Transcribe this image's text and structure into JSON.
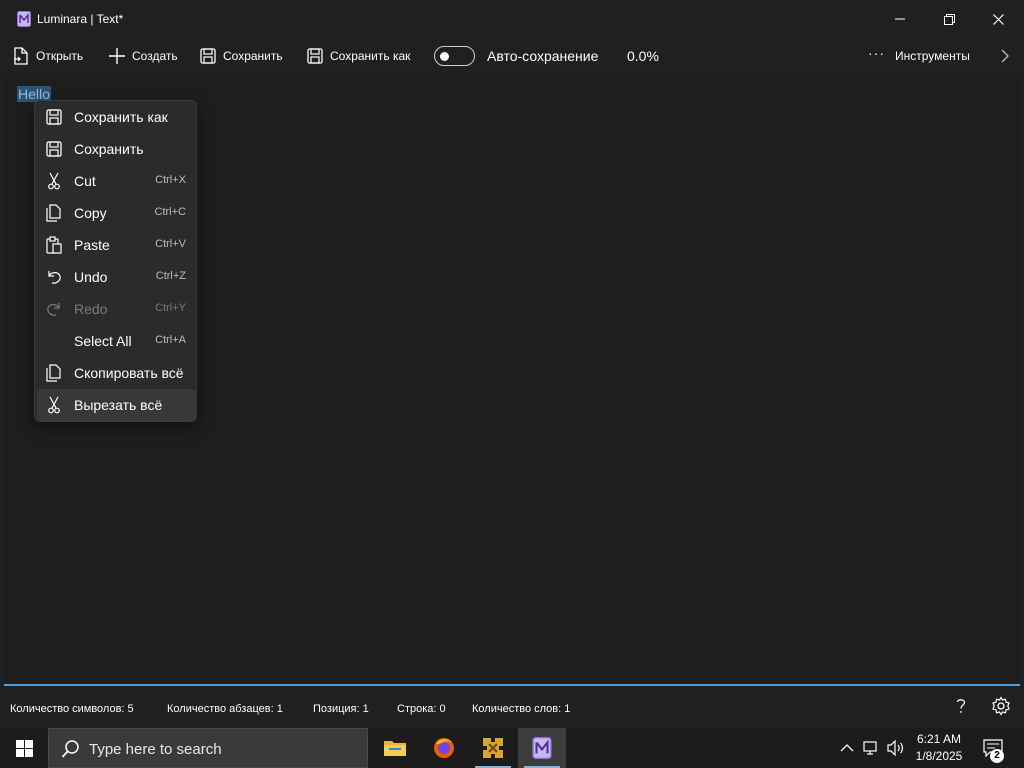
{
  "window": {
    "title": "Luminara | Text*"
  },
  "toolbar": {
    "open_label": "Открыть",
    "new_label": "Создать",
    "save_label": "Сохранить",
    "save_as_label": "Сохранить как",
    "autosave_label": "Авто-сохранение",
    "autosave_on": false,
    "progress_text": "0.0%",
    "tools_label": "Инструменты"
  },
  "editor": {
    "text": "Hello",
    "selected": true
  },
  "context_menu": {
    "items": [
      {
        "label": "Сохранить как",
        "shortcut": "",
        "icon": "save-as-icon",
        "enabled": true
      },
      {
        "label": "Сохранить",
        "shortcut": "",
        "icon": "save-icon",
        "enabled": true
      },
      {
        "label": "Cut",
        "shortcut": "Ctrl+X",
        "icon": "scissors-icon",
        "enabled": true
      },
      {
        "label": "Copy",
        "shortcut": "Ctrl+C",
        "icon": "copy-icon",
        "enabled": true
      },
      {
        "label": "Paste",
        "shortcut": "Ctrl+V",
        "icon": "paste-icon",
        "enabled": true
      },
      {
        "label": "Undo",
        "shortcut": "Ctrl+Z",
        "icon": "undo-icon",
        "enabled": true
      },
      {
        "label": "Redo",
        "shortcut": "Ctrl+Y",
        "icon": "redo-icon",
        "enabled": false
      },
      {
        "label": "Select All",
        "shortcut": "Ctrl+A",
        "icon": "",
        "enabled": true
      },
      {
        "label": "Скопировать всё",
        "shortcut": "",
        "icon": "copy-icon",
        "enabled": true
      },
      {
        "label": "Вырезать всё",
        "shortcut": "",
        "icon": "scissors-icon",
        "enabled": true,
        "hovered": true
      }
    ]
  },
  "status": {
    "chars": "Количество символов: 5",
    "paragraphs": "Количество абзацев: 1",
    "position": "Позиция: 1",
    "line": "Строка: 0",
    "words": "Количество слов: 1"
  },
  "taskbar": {
    "search_placeholder": "Type here to search",
    "time": "6:21 AM",
    "date": "1/8/2025",
    "notification_count": "2"
  },
  "colors": {
    "accent": "#4a9ee6",
    "selection": "#2a5478",
    "background": "#202020"
  }
}
